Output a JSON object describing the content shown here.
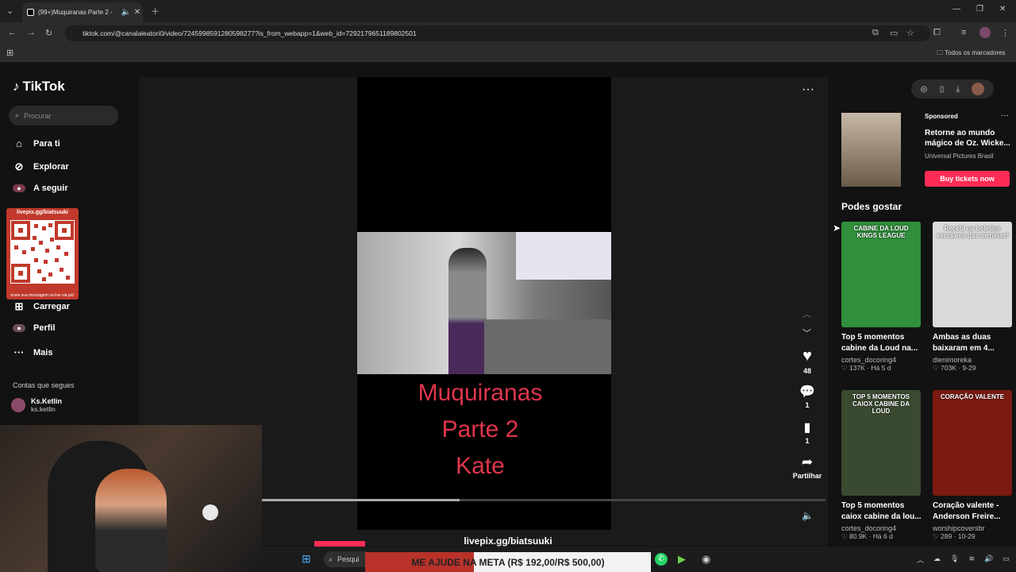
{
  "browser": {
    "tab_title": "(99+)Muquiranas Parte 2 -",
    "url": "tiktok.com/@canalaleatori0/video/7245998591280598277?is_from_webapp=1&web_id=7292179651189802501",
    "bookmarks_label": "Todos os marcadores"
  },
  "sidebar": {
    "logo": "TikTok",
    "search_placeholder": "Procurar",
    "nav": [
      "Para ti",
      "Explorar",
      "A seguir",
      "Carregar",
      "Perfil",
      "Mais"
    ],
    "qr_title": "livepix.gg/biatsuuki",
    "qr_footer": "envie sua mensagem na live via pix!",
    "following_label": "Contas que segues",
    "following": [
      {
        "name": "Ks.Ketlin",
        "handle": "ks.ketlin"
      }
    ]
  },
  "video": {
    "title_lines": [
      "Muquiranas",
      "Parte 2",
      "Kate"
    ],
    "likes": "48",
    "comments": "1",
    "saves": "1",
    "share_label": "Partilhar",
    "progress": 0.35
  },
  "overlay": {
    "livepix": "livepix.gg/biatsuuki",
    "meta_bar": "ME AJUDE NA META (R$ 192,00/R$ 500,00)",
    "taskbar_search": "Pesqui"
  },
  "right": {
    "sponsored_label": "Sponsored",
    "ad_title": "Retorne ao mundo mágico de Oz. Wicke...",
    "ad_advertiser": "Universal Pictures Brasil",
    "ad_button": "Buy tickets now",
    "section_title": "Podes gostar",
    "items": [
      {
        "title": "Top 5 momentos cabine da Loud na...",
        "author": "cortes_docoring4",
        "likes": "137K",
        "age": "Há 5 d",
        "thumb_text": "CABINE DA LOUD KINGS LEAGUE",
        "color": "#2f8f3a"
      },
      {
        "title": "Ambas as duas baixaram em 4...",
        "author": "dienimoreka",
        "likes": "703K",
        "age": "9-29",
        "thumb_text": "Recebi os boletins escolares das meninas!",
        "color": "#d9d9d9"
      },
      {
        "title": "Top 5 momentos caiox cabine da lou...",
        "author": "cortes_docoring4",
        "likes": "80.9K",
        "age": "Há 6 d",
        "thumb_text": "TOP 5 MOMENTOS CAIOX CABINE DA LOUD",
        "color": "#3a4a30"
      },
      {
        "title": "Coração valente - Anderson Freire...",
        "author": "worshipcoversbr",
        "likes": "289",
        "age": "10-29",
        "thumb_text": "CORAÇÃO VALENTE",
        "color": "#7a1a10"
      }
    ]
  }
}
